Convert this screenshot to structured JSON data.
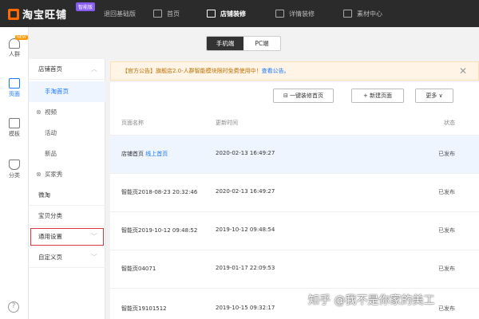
{
  "topbar": {
    "logo": "淘宝旺铺",
    "badge": "智能版",
    "back": "退回基础版",
    "nav": [
      "首页",
      "店铺装修",
      "详情装修",
      "素材中心"
    ]
  },
  "rail": {
    "new_badge": "NEW",
    "items": [
      "人群",
      "页面",
      "模板",
      "分类"
    ],
    "help": "?"
  },
  "menu": {
    "items": [
      "店铺首页",
      "手淘首页",
      "视频",
      "活动",
      "新品",
      "买家秀",
      "微淘",
      "宝贝分类",
      "通用设置",
      "自定义页"
    ]
  },
  "toggle": {
    "mobile": "手机端",
    "pc": "PC端"
  },
  "notice": {
    "text": "【官方公告】旗舰店2.0-人群智能模块限时免费使用中！",
    "link": "查看公告。"
  },
  "toolbar": {
    "decorate": "一键装修首页",
    "new_page": "+ 新建页面",
    "more": "更多"
  },
  "table": {
    "headers": {
      "name": "页面名称",
      "time": "更新时间",
      "status": "状态"
    },
    "rows": [
      {
        "name": "店铺首页",
        "tag": "线上首页",
        "time": "2020-02-13 16:49:27",
        "status": "已发布"
      },
      {
        "name": "智能页2018-08-23 20:32:46",
        "tag": "",
        "time": "2020-02-13 16:49:27",
        "status": "已发布"
      },
      {
        "name": "智能页2019-10-12 09:48:52",
        "tag": "",
        "time": "2019-10-12 09:48:54",
        "status": "已发布"
      },
      {
        "name": "智能页04071",
        "tag": "",
        "time": "2019-01-17 22:09:53",
        "status": "已发布"
      },
      {
        "name": "智能页19101512",
        "tag": "",
        "time": "2019-10-15 09:32:17",
        "status": "已发布"
      }
    ]
  },
  "watermark": "知乎 @我不是你家的美工"
}
